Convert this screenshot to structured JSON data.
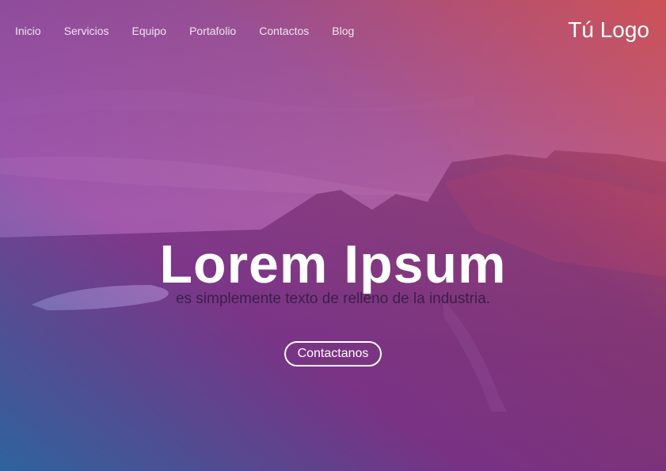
{
  "nav": {
    "links": [
      "Inicio",
      "Servicios",
      "Equipo",
      "Portafolio",
      "Contactos",
      "Blog"
    ],
    "logo": "Tú Logo"
  },
  "hero": {
    "title": "Lorem Ipsum",
    "subtitle": "es simplemente texto de relleno de la industria.",
    "cta_label": "Contactanos"
  },
  "colors": {
    "gradient_blue": "#2a6eaa",
    "gradient_purple": "#9a3caa",
    "gradient_red": "#e0504a",
    "text_light": "#ffffff",
    "subtitle_dark": "#3b1e4a"
  }
}
